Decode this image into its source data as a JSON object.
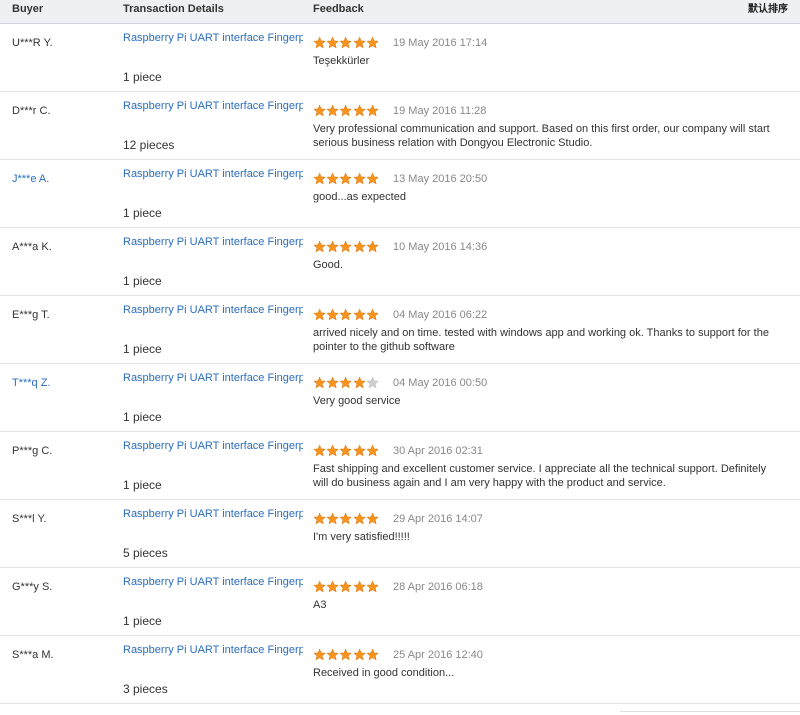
{
  "header": {
    "buyer": "Buyer",
    "details": "Transaction Details",
    "feedback": "Feedback",
    "sort": "默认排序"
  },
  "colors": {
    "link": "#2a6dc0",
    "star_on": "#f7941d",
    "star_off": "#cfcfcf",
    "header_bg": "#eef0f4"
  },
  "reviews": [
    {
      "buyer": "U***R Y.",
      "buyer_link": false,
      "product": "Raspberry Pi UART interface Fingerp...",
      "qty": "1 piece",
      "stars": 5,
      "date": "19 May 2016 17:14",
      "comment": "Teşekkürler"
    },
    {
      "buyer": "D***r C.",
      "buyer_link": false,
      "product": "Raspberry Pi UART interface Fingerp...",
      "qty": "12 pieces",
      "stars": 5,
      "date": "19 May 2016 11:28",
      "comment": "Very professional communication and support. Based on this first order, our company will start serious business relation with Dongyou Electronic Studio."
    },
    {
      "buyer": "J***e A.",
      "buyer_link": true,
      "product": "Raspberry Pi UART interface Fingerp...",
      "qty": "1 piece",
      "stars": 5,
      "date": "13 May 2016 20:50",
      "comment": "good...as expected"
    },
    {
      "buyer": "A***a K.",
      "buyer_link": false,
      "product": "Raspberry Pi UART interface Fingerp...",
      "qty": "1 piece",
      "stars": 5,
      "date": "10 May 2016 14:36",
      "comment": "Good."
    },
    {
      "buyer": "E***g T.",
      "buyer_link": false,
      "product": "Raspberry Pi UART interface Fingerp...",
      "qty": "1 piece",
      "stars": 5,
      "date": "04 May 2016 06:22",
      "comment": "arrived nicely and on time. tested with windows app and working ok. Thanks to support for the pointer to the github software"
    },
    {
      "buyer": "T***q Z.",
      "buyer_link": true,
      "product": "Raspberry Pi UART interface Fingerp...",
      "qty": "1 piece",
      "stars": 4,
      "date": "04 May 2016 00:50",
      "comment": "Very good service"
    },
    {
      "buyer": "P***g C.",
      "buyer_link": false,
      "product": "Raspberry Pi UART interface Fingerp...",
      "qty": "1 piece",
      "stars": 5,
      "date": "30 Apr 2016 02:31",
      "comment": "Fast shipping and excellent customer service. I appreciate all the technical support. Definitely will do business again and I am very happy with the product and service."
    },
    {
      "buyer": "S***l Y.",
      "buyer_link": false,
      "product": "Raspberry Pi UART interface Fingerp...",
      "qty": "5 pieces",
      "stars": 5,
      "date": "29 Apr 2016 14:07",
      "comment": "I'm very satisfied!!!!!"
    },
    {
      "buyer": "G***y S.",
      "buyer_link": false,
      "product": "Raspberry Pi UART interface Fingerp...",
      "qty": "1 piece",
      "stars": 5,
      "date": "28 Apr 2016 06:18",
      "comment": "A3"
    },
    {
      "buyer": "S***a M.",
      "buyer_link": false,
      "product": "Raspberry Pi UART interface Fingerp...",
      "qty": "3 pieces",
      "stars": 5,
      "date": "25 Apr 2016 12:40",
      "comment": "Received in good condition..."
    }
  ]
}
